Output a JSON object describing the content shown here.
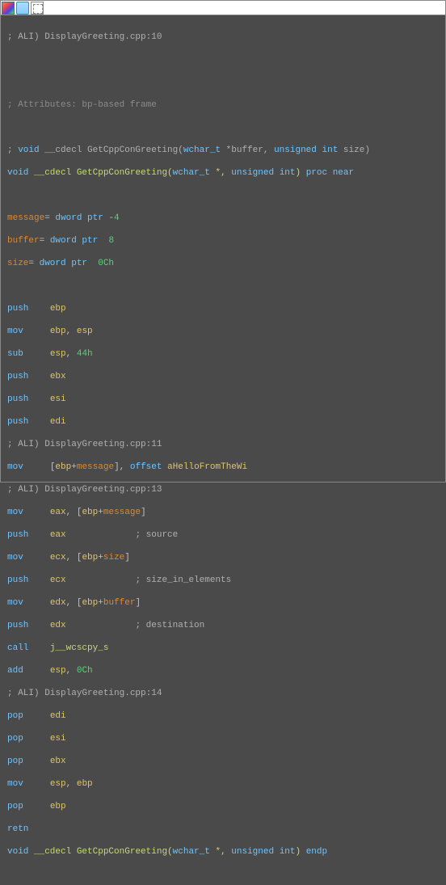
{
  "toolbar": {
    "icons": [
      "color-palette-icon",
      "display-icon",
      "selection-icon"
    ]
  },
  "code": {
    "l1_a": "; ALI)",
    "l1_b": " DisplayGreeting.cpp:10",
    "l2": "",
    "l3": "",
    "l4": "; Attributes: bp-based frame",
    "l5": "",
    "l6_a": "; ",
    "l6_b": "void",
    "l6_c": " __cdecl GetCppConGreeting(",
    "l6_d": "wchar_t",
    "l6_e": " *buffer, ",
    "l6_f": "unsigned",
    "l6_g": " ",
    "l6_h": "int",
    "l6_i": " size)",
    "l7_a": "void",
    "l7_b": " __cdecl ",
    "l7_c": "GetCppConGreeting",
    "l7_d": "(",
    "l7_e": "wchar_t",
    "l7_f": " *, ",
    "l7_g": "unsigned int",
    "l7_h": ") ",
    "l7_i": "proc near",
    "l8": "",
    "l9_a": "message",
    "l9_b": "= ",
    "l9_c": "dword ptr",
    "l9_d": " -",
    "l9_e": "4",
    "l10_a": "buffer",
    "l10_b": "= ",
    "l10_c": "dword ptr",
    "l10_d": "  ",
    "l10_e": "8",
    "l11_a": "size",
    "l11_b": "= ",
    "l11_c": "dword ptr",
    "l11_d": "  ",
    "l11_e": "0Ch",
    "l12": "",
    "l13_a": "push",
    "l13_b": "    ",
    "l13_c": "ebp",
    "l14_a": "mov",
    "l14_b": "     ",
    "l14_c": "ebp",
    "l14_d": ", ",
    "l14_e": "esp",
    "l15_a": "sub",
    "l15_b": "     ",
    "l15_c": "esp",
    "l15_d": ", ",
    "l15_e": "44h",
    "l16_a": "push",
    "l16_b": "    ",
    "l16_c": "ebx",
    "l17_a": "push",
    "l17_b": "    ",
    "l17_c": "esi",
    "l18_a": "push",
    "l18_b": "    ",
    "l18_c": "edi",
    "l19_a": "; ALI)",
    "l19_b": " DisplayGreeting.cpp:11",
    "l20_a": "mov",
    "l20_b": "     [",
    "l20_c": "ebp",
    "l20_d": "+",
    "l20_e": "message",
    "l20_f": "], ",
    "l20_g": "offset",
    "l20_h": " ",
    "l20_i": "aHelloFromTheWi",
    "l21_a": "; ALI)",
    "l21_b": " DisplayGreeting.cpp:13",
    "l22_a": "mov",
    "l22_b": "     ",
    "l22_c": "eax",
    "l22_d": ", [",
    "l22_e": "ebp",
    "l22_f": "+",
    "l22_g": "message",
    "l22_h": "]",
    "l23_a": "push",
    "l23_b": "    ",
    "l23_c": "eax",
    "l23_d": "             ; source",
    "l24_a": "mov",
    "l24_b": "     ",
    "l24_c": "ecx",
    "l24_d": ", [",
    "l24_e": "ebp",
    "l24_f": "+",
    "l24_g": "size",
    "l24_h": "]",
    "l25_a": "push",
    "l25_b": "    ",
    "l25_c": "ecx",
    "l25_d": "             ; size_in_elements",
    "l26_a": "mov",
    "l26_b": "     ",
    "l26_c": "edx",
    "l26_d": ", [",
    "l26_e": "ebp",
    "l26_f": "+",
    "l26_g": "buffer",
    "l26_h": "]",
    "l27_a": "push",
    "l27_b": "    ",
    "l27_c": "edx",
    "l27_d": "             ; destination",
    "l28_a": "call",
    "l28_b": "    ",
    "l28_c": "j__wcscpy_s",
    "l29_a": "add",
    "l29_b": "     ",
    "l29_c": "esp",
    "l29_d": ", ",
    "l29_e": "0Ch",
    "l30_a": "; ALI)",
    "l30_b": " DisplayGreeting.cpp:14",
    "l31_a": "pop",
    "l31_b": "     ",
    "l31_c": "edi",
    "l32_a": "pop",
    "l32_b": "     ",
    "l32_c": "esi",
    "l33_a": "pop",
    "l33_b": "     ",
    "l33_c": "ebx",
    "l34_a": "mov",
    "l34_b": "     ",
    "l34_c": "esp",
    "l34_d": ", ",
    "l34_e": "ebp",
    "l35_a": "pop",
    "l35_b": "     ",
    "l35_c": "ebp",
    "l36_a": "retn",
    "l37_a": "void",
    "l37_b": " __cdecl ",
    "l37_c": "GetCppConGreeting",
    "l37_d": "(",
    "l37_e": "wchar_t",
    "l37_f": " *, ",
    "l37_g": "unsigned int",
    "l37_h": ") ",
    "l37_i": "endp"
  }
}
